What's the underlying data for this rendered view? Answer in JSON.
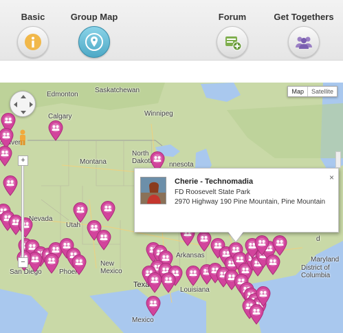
{
  "tabs": [
    {
      "label": "Basic",
      "icon": "info-icon"
    },
    {
      "label": "Group Map",
      "icon": "map-pin-icon"
    },
    {
      "label": "Forum",
      "icon": "forum-add-icon"
    },
    {
      "label": "Get Togethers",
      "icon": "people-group-icon"
    }
  ],
  "map": {
    "type_buttons": {
      "map": "Map",
      "satellite": "Satellite"
    },
    "zoom": {
      "in": "+",
      "out": "−"
    },
    "labels": {
      "edmonton": "Edmonton",
      "saskatchewan": "Saskatchewan",
      "calgary": "Calgary",
      "winnipeg": "Winnipeg",
      "north_dakota": "North\nDakota",
      "montana": "Montana",
      "nnesota": "nnesota",
      "couver": "couver",
      "nevada": "Nevada",
      "utah": "Utah",
      "new_mexico": "New\nMexico",
      "phoen": "Phoen",
      "san_diego": "San Diego",
      "arkansas": "Arkansas",
      "texas": "Texas",
      "louisiana": "Louisiana",
      "mexico": "Mexico",
      "maryland": "Maryland",
      "district_of_columbia": "District of\nColumbia",
      "d_place": "d"
    }
  },
  "info_window": {
    "name": "Cherie - Technomadia",
    "place": "FD Roosevelt State Park",
    "address": "2970 Highway 190 Pine Mountain, Pine Mountain",
    "close": "×"
  },
  "colors": {
    "active_tab": "#4ea9c6",
    "marker": "#d2449c",
    "info_orange": "#e8b34a",
    "land": "#c9d9a7",
    "water": "#a9c8ee"
  }
}
